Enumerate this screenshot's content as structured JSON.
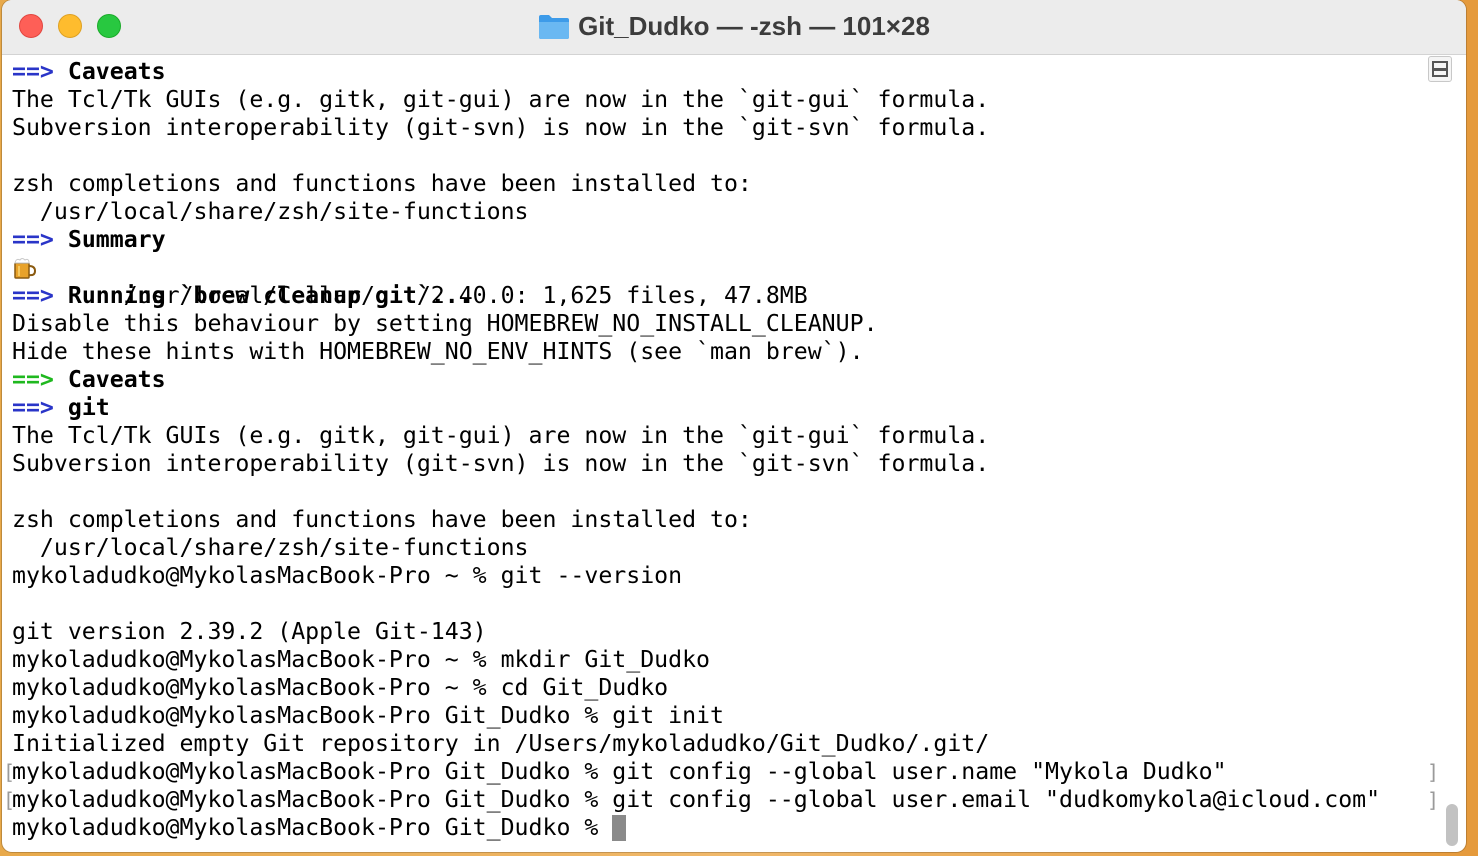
{
  "window": {
    "title": "Git_Dudko — -zsh — 101×28"
  },
  "terminal": {
    "lines": {
      "l0": {
        "arrow": "==>",
        "text": "Caveats"
      },
      "l1": "The Tcl/Tk GUIs (e.g. gitk, git-gui) are now in the `git-gui` formula.",
      "l2": "Subversion interoperability (git-svn) is now in the `git-svn` formula.",
      "l4": "zsh completions and functions have been installed to:",
      "l5": "  /usr/local/share/zsh/site-functions",
      "l6": {
        "arrow": "==>",
        "text": "Summary"
      },
      "l7": "  /usr/local/Cellar/git/2.40.0: 1,625 files, 47.8MB",
      "l8": {
        "arrow": "==>",
        "text": "Running `brew cleanup git`..."
      },
      "l9": "Disable this behaviour by setting HOMEBREW_NO_INSTALL_CLEANUP.",
      "l10": "Hide these hints with HOMEBREW_NO_ENV_HINTS (see `man brew`).",
      "l11": {
        "arrow": "==>",
        "text": "Caveats"
      },
      "l12": {
        "arrow": "==>",
        "text": "git"
      },
      "l13": "The Tcl/Tk GUIs (e.g. gitk, git-gui) are now in the `git-gui` formula.",
      "l14": "Subversion interoperability (git-svn) is now in the `git-svn` formula.",
      "l16": "zsh completions and functions have been installed to:",
      "l17": "  /usr/local/share/zsh/site-functions",
      "l18": "mykoladudko@MykolasMacBook-Pro ~ % git --version",
      "l20": "git version 2.39.2 (Apple Git-143)",
      "l21": "mykoladudko@MykolasMacBook-Pro ~ % mkdir Git_Dudko",
      "l22": "mykoladudko@MykolasMacBook-Pro ~ % cd Git_Dudko",
      "l23": "mykoladudko@MykolasMacBook-Pro Git_Dudko % git init",
      "l24": "Initialized empty Git repository in /Users/mykoladudko/Git_Dudko/.git/",
      "l25": "mykoladudko@MykolasMacBook-Pro Git_Dudko % git config --global user.name \"Mykola Dudko\"",
      "l26": "mykoladudko@MykolasMacBook-Pro Git_Dudko % git config --global user.email \"dudkomykola@icloud.com\"",
      "l27": "mykoladudko@MykolasMacBook-Pro Git_Dudko % "
    },
    "mark_open": "[",
    "mark_close": "]"
  },
  "colors": {
    "arrow_blue": "#2a35c8",
    "arrow_green": "#1fb81f",
    "cursor": "#8a8a8a"
  },
  "icons": {
    "folder": "folder-icon",
    "beer": "beer-mug-icon"
  }
}
